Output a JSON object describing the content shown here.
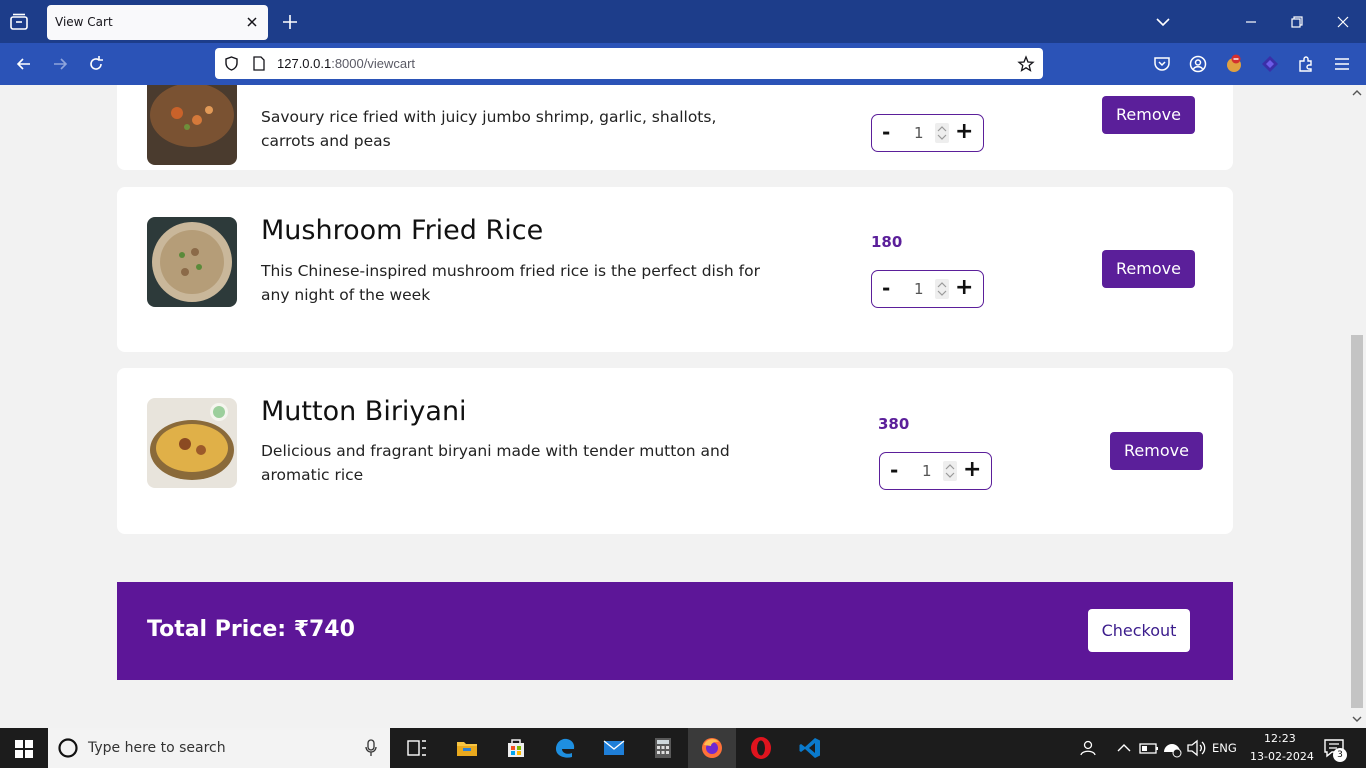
{
  "browser": {
    "tab_title": "View Cart",
    "url_host": "127.0.0.1",
    "url_rest": ":8000/viewcart"
  },
  "cart": {
    "items": [
      {
        "name": "",
        "description": "Savoury rice fried with juicy jumbo shrimp, garlic, shallots, carrots and peas",
        "price": "",
        "quantity": "1",
        "remove_label": "Remove"
      },
      {
        "name": "Mushroom Fried Rice",
        "description": "This Chinese-inspired mushroom fried rice is the perfect dish for any night of the week",
        "price": "180",
        "quantity": "1",
        "remove_label": "Remove"
      },
      {
        "name": "Mutton Biriyani",
        "description": "Delicious and fragrant biryani made with tender mutton and aromatic rice",
        "price": "380",
        "quantity": "1",
        "remove_label": "Remove"
      }
    ],
    "minus_label": "-",
    "plus_label": "+",
    "total_label": "Total Price: ₹740",
    "checkout_label": "Checkout"
  },
  "taskbar": {
    "search_placeholder": "Type here to search",
    "language": "ENG",
    "time": "12:23",
    "date": "13-02-2024",
    "notification_count": "3"
  },
  "colors": {
    "accent": "#5b1f9a",
    "total_bar": "#5d1698",
    "tabbar": "#1d3d8a",
    "navbar": "#2b53b7"
  }
}
